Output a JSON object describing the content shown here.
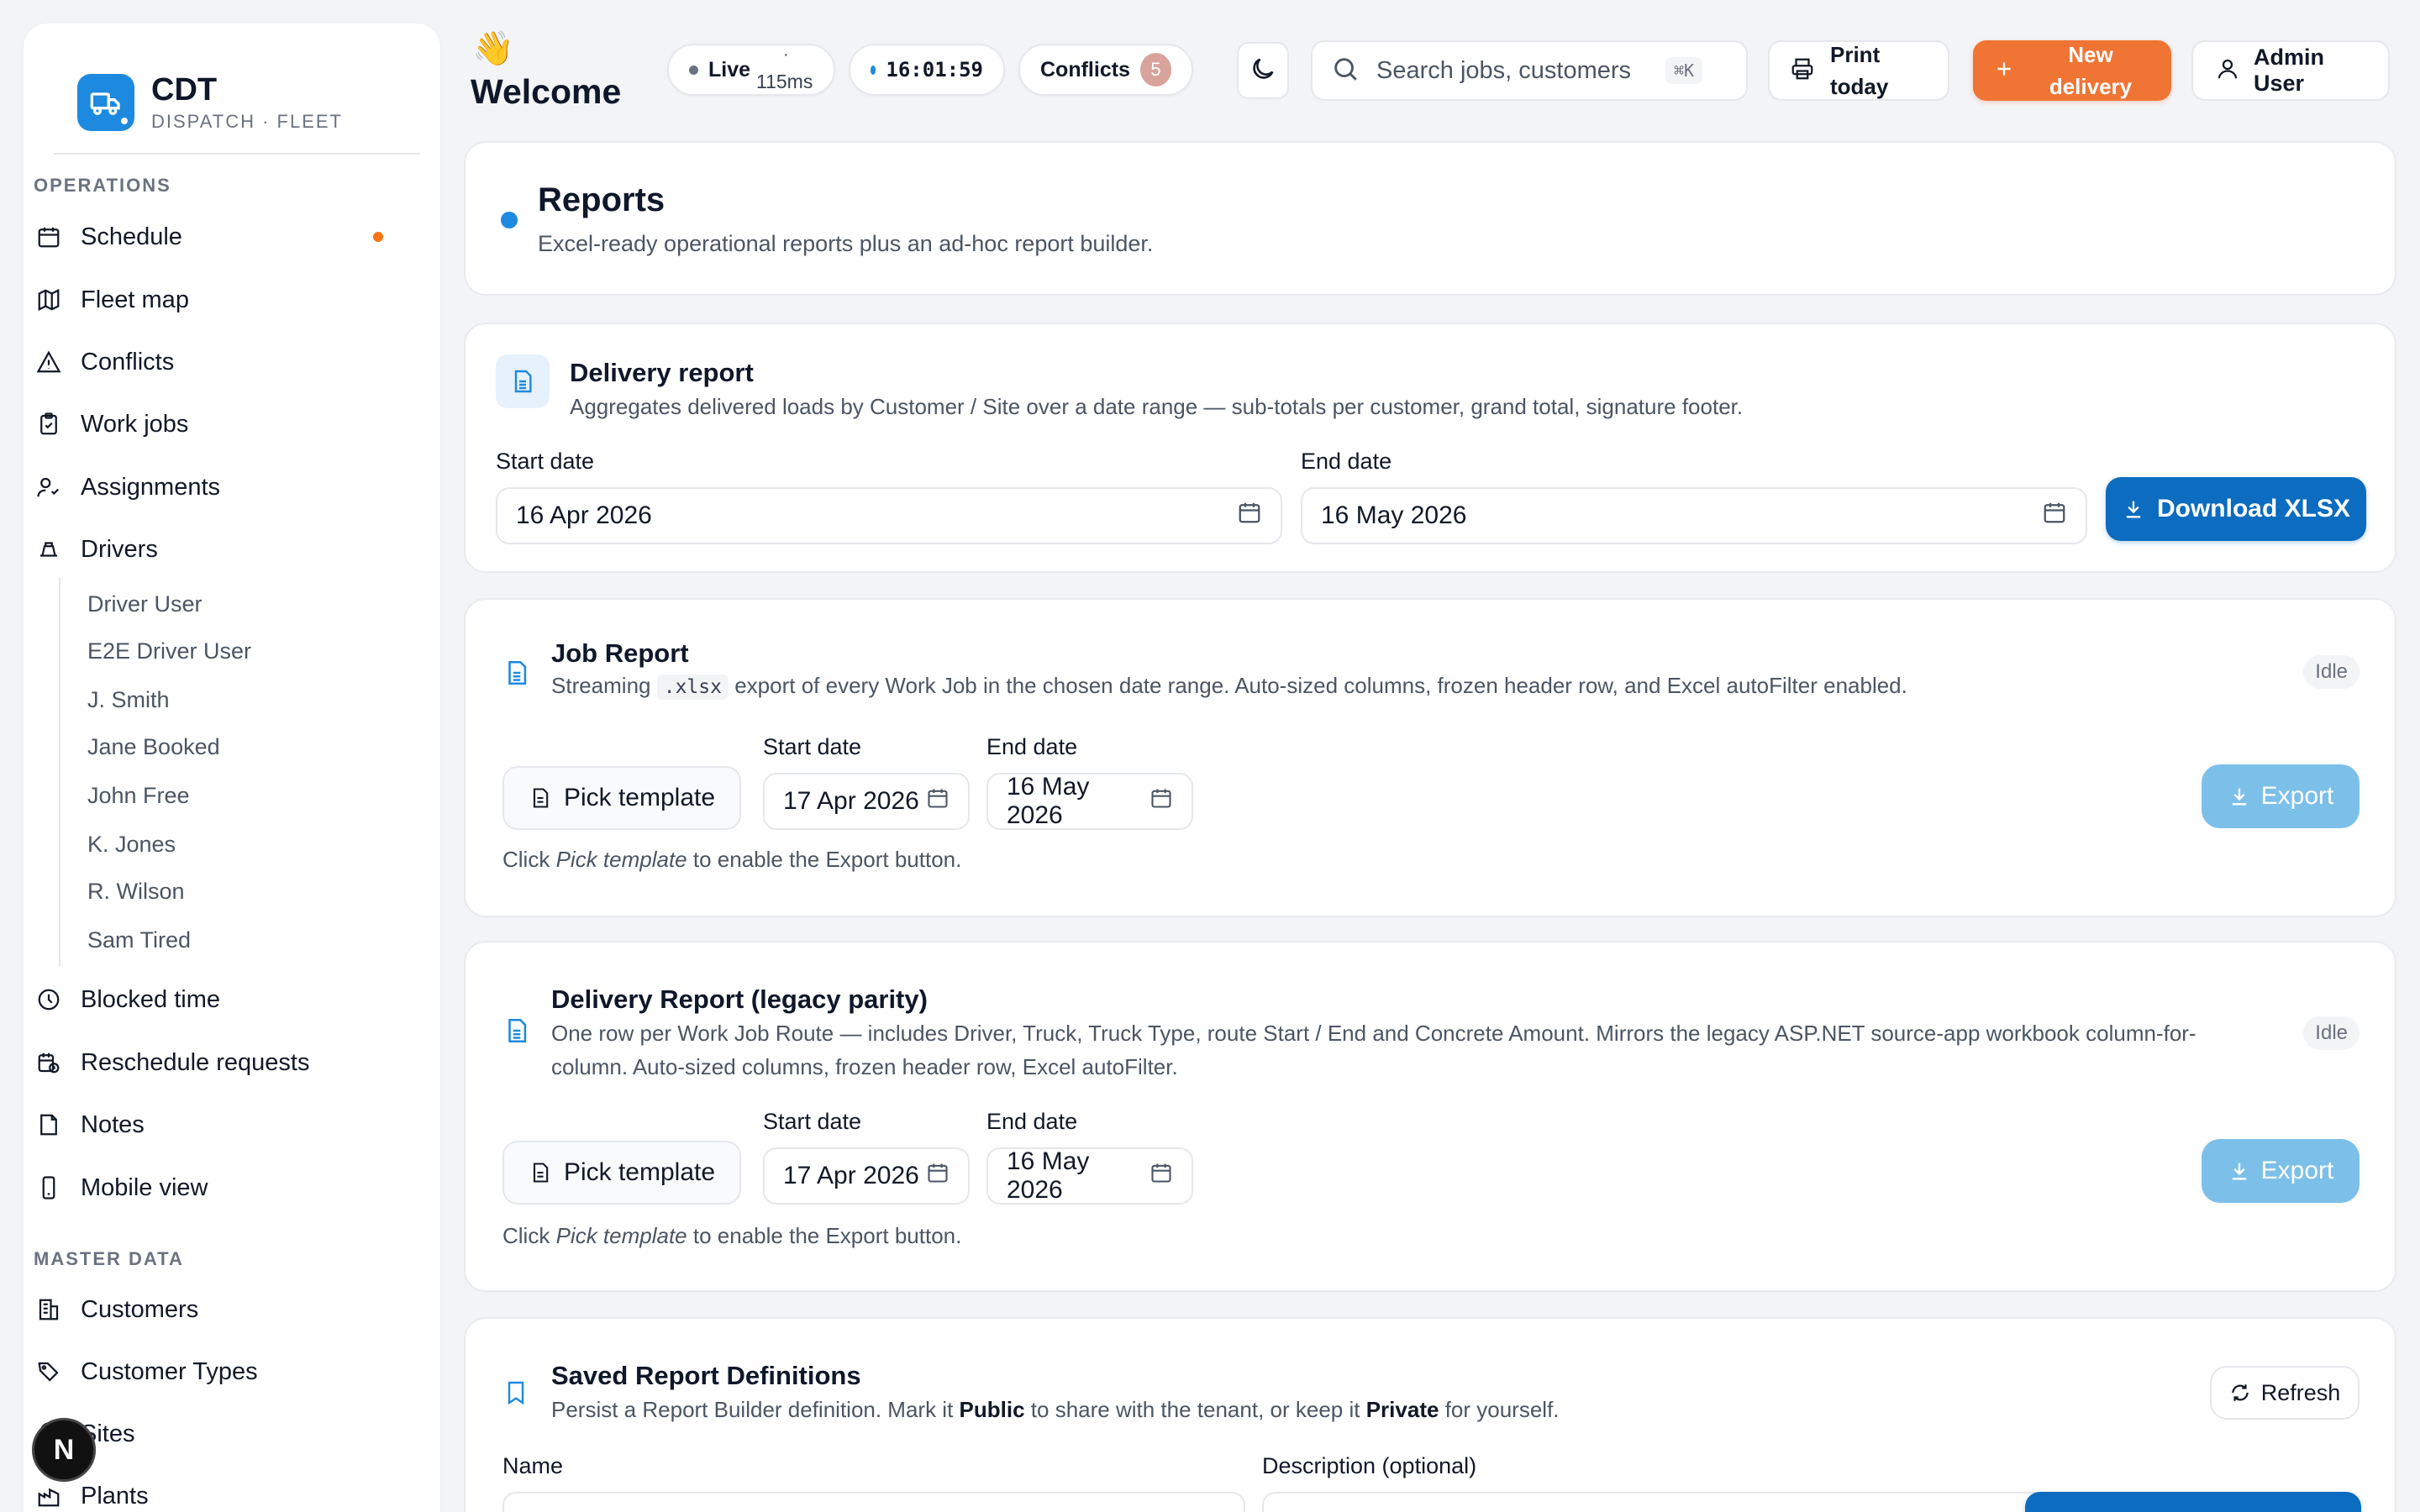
{
  "brand": {
    "name": "CDT",
    "subtitle": "DISPATCH · FLEET"
  },
  "sidebar": {
    "sections": [
      {
        "label": "OPERATIONS"
      },
      {
        "label": "MASTER DATA"
      }
    ],
    "items": [
      {
        "label": "Schedule",
        "icon": "calendar-icon",
        "dot": true
      },
      {
        "label": "Fleet map",
        "icon": "map-icon"
      },
      {
        "label": "Conflicts",
        "icon": "warning-icon"
      },
      {
        "label": "Work jobs",
        "icon": "clipboard-icon"
      },
      {
        "label": "Assignments",
        "icon": "user-assign-icon"
      },
      {
        "label": "Drivers",
        "icon": "steering-icon"
      },
      {
        "label": "Blocked time",
        "icon": "clock-icon"
      },
      {
        "label": "Reschedule requests",
        "icon": "calendar-clock-icon"
      },
      {
        "label": "Notes",
        "icon": "note-icon"
      },
      {
        "label": "Mobile view",
        "icon": "phone-icon"
      },
      {
        "label": "Customers",
        "icon": "building-icon"
      },
      {
        "label": "Customer Types",
        "icon": "tags-icon"
      },
      {
        "label": "Sites",
        "icon": "pin-icon"
      },
      {
        "label": "Plants",
        "icon": "factory-icon"
      }
    ],
    "drivers": [
      "Driver User",
      "E2E Driver User",
      "J. Smith",
      "Jane Booked",
      "John Free",
      "K. Jones",
      "R. Wilson",
      "Sam Tired"
    ]
  },
  "header": {
    "emoji": "👋",
    "welcome": "Welcome",
    "live_label": "Live",
    "live_dot": "·",
    "latency": "115ms",
    "clock": "16:01:59",
    "conflicts_label": "Conflicts",
    "conflicts_count": "5",
    "search_placeholder": "Search jobs, customers",
    "search_shortcut": "⌘K",
    "print_label": "Print today",
    "new_label": "New delivery",
    "user_label": "Admin User"
  },
  "page": {
    "title": "Reports",
    "subtitle": "Excel-ready operational reports plus an ad-hoc report builder."
  },
  "delivery_report": {
    "title": "Delivery report",
    "description": "Aggregates delivered loads by Customer / Site over a date range — sub-totals per customer, grand total, signature footer.",
    "start_label": "Start date",
    "start_value": "16 Apr 2026",
    "end_label": "End date",
    "end_value": "16 May 2026",
    "download_label": "Download XLSX"
  },
  "job_report": {
    "title": "Job Report",
    "desc_prefix": "Streaming",
    "desc_code": ".xlsx",
    "desc_suffix": "export of every Work Job in the chosen date range. Auto-sized columns, frozen header row, and Excel autoFilter enabled.",
    "status": "Idle",
    "template_label": "Pick template",
    "start_label": "Start date",
    "start_value": "17 Apr 2026",
    "end_label": "End date",
    "end_value": "16 May 2026",
    "export_label": "Export",
    "hint_prefix": "Click",
    "hint_em": "Pick template",
    "hint_suffix": "to enable the Export button."
  },
  "legacy_report": {
    "title": "Delivery Report (legacy parity)",
    "description": "One row per Work Job Route — includes Driver, Truck, Truck Type, route Start / End and Concrete Amount. Mirrors the legacy ASP.NET source-app workbook column-for-column. Auto-sized columns, frozen header row, Excel autoFilter.",
    "status": "Idle",
    "template_label": "Pick template",
    "start_label": "Start date",
    "start_value": "17 Apr 2026",
    "end_label": "End date",
    "end_value": "16 May 2026",
    "export_label": "Export",
    "hint_prefix": "Click",
    "hint_em": "Pick template",
    "hint_suffix": "to enable the Export button."
  },
  "saved": {
    "title": "Saved Report Definitions",
    "desc_1": "Persist a Report Builder definition. Mark it",
    "desc_public": "Public",
    "desc_2": "to share with the tenant, or keep it",
    "desc_private": "Private",
    "desc_3": "for yourself.",
    "refresh_label": "Refresh",
    "name_label": "Name",
    "description_label": "Description (optional)"
  },
  "colors": {
    "accent": "#1d8ae0",
    "primary_button": "#0c6cbf",
    "new_button": "#f07434",
    "export_disabled": "#7cc0ea",
    "notification_dot": "#f97316"
  }
}
